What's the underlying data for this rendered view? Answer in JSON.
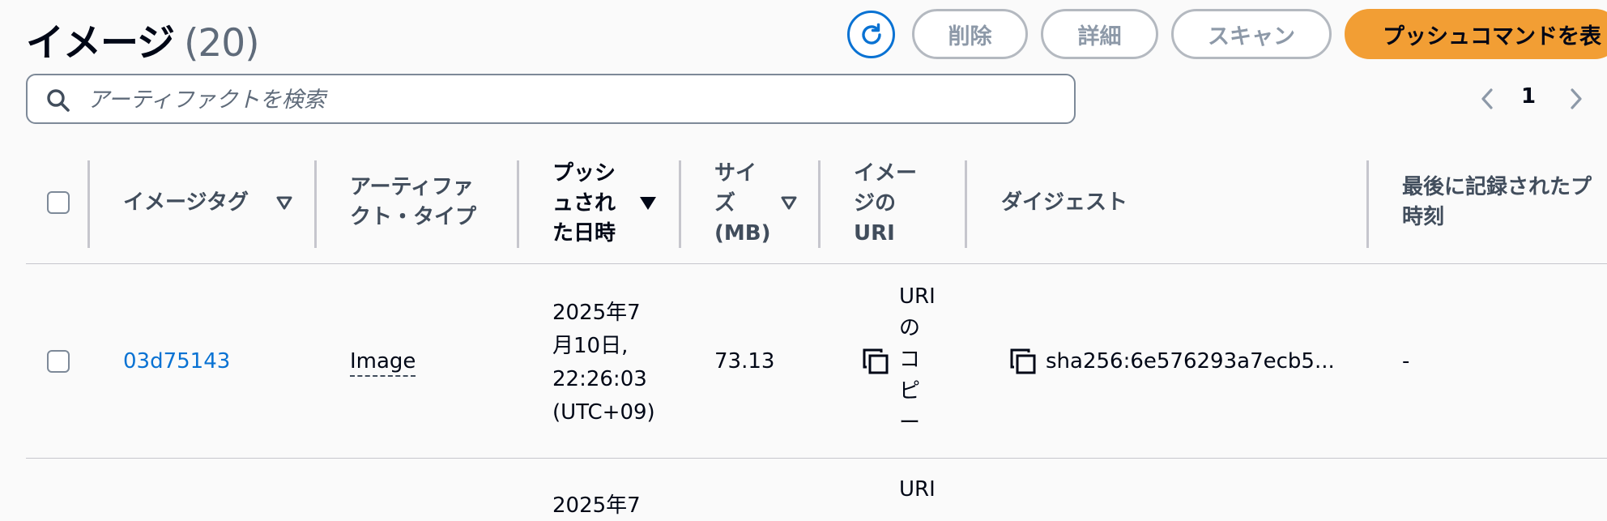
{
  "header": {
    "title": "イメージ",
    "count": "(20)",
    "buttons": {
      "delete": "削除",
      "details": "詳細",
      "scan": "スキャン",
      "push_commands": "プッシュコマンドを表"
    },
    "refresh_icon": "refresh-icon"
  },
  "search": {
    "placeholder": "アーティファクトを検索",
    "value": ""
  },
  "pagination": {
    "current_page": "1"
  },
  "table": {
    "columns": {
      "image_tag": "イメージタグ",
      "artifact_type_1": "アーティファ",
      "artifact_type_2": "クト・タイプ",
      "pushed_at_1": "プッシ",
      "pushed_at_2": "ュされ",
      "pushed_at_3": "た日時",
      "size_1": "サイ",
      "size_2": "ズ",
      "size_3": "(MB)",
      "image_uri_1": "イメー",
      "image_uri_2": "ジの",
      "image_uri_3": "URI",
      "digest": "ダイジェスト",
      "last_recorded_1": "最後に記録されたプ",
      "last_recorded_2": "時刻"
    },
    "rows": [
      {
        "tag": "03d75143",
        "type": "Image",
        "pushed_1": "2025年7",
        "pushed_2": "月10日,",
        "pushed_3": "22:26:03",
        "pushed_4": "(UTC+09)",
        "size": "73.13",
        "uri_1": "URI",
        "uri_2": "の",
        "uri_3": "コ",
        "uri_4": "ピ",
        "uri_5": "ー",
        "digest": "sha256:6e576293a7ecb5...",
        "last_recorded": "-"
      },
      {
        "pushed_1": "2025年7",
        "uri_1": "URI"
      }
    ]
  },
  "colors": {
    "accent": "#0972d3",
    "primary_button": "#f29e34",
    "background": "#fafafa"
  }
}
